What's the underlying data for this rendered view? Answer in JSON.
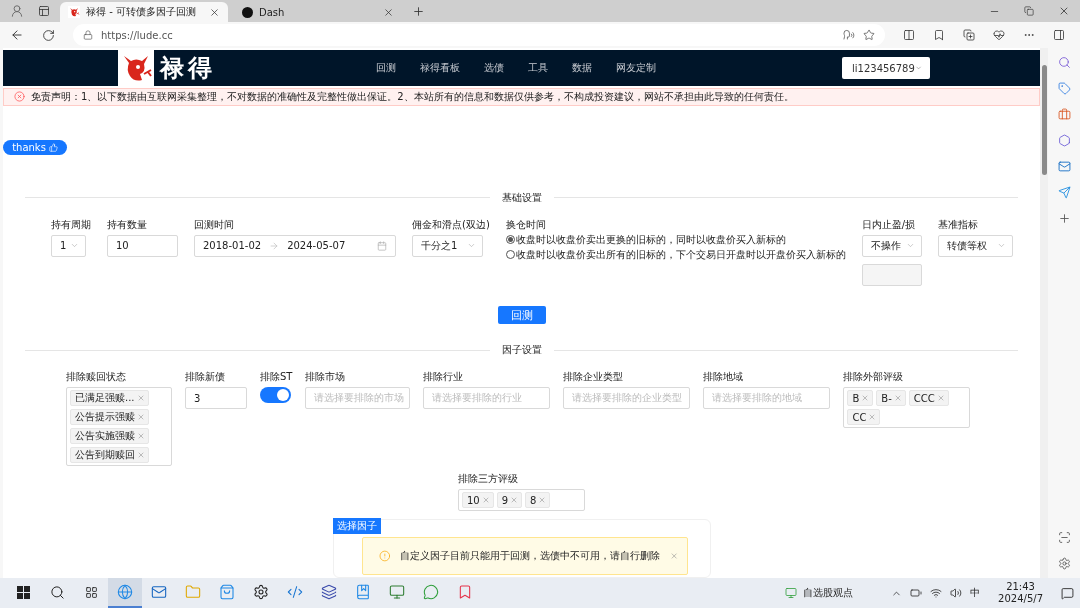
{
  "browser": {
    "tabs": [
      {
        "title": "禄得 - 可转债多因子回测",
        "selected": true
      },
      {
        "title": "Dash",
        "selected": false
      }
    ],
    "url": "https://lude.cc"
  },
  "navbar": {
    "brand": "禄得",
    "items": [
      "回测",
      "禄得看板",
      "选债",
      "工具",
      "数据",
      "网友定制"
    ],
    "user": "li123456789"
  },
  "alert": "免责声明：1、以下数据由互联网采集整理，不对数据的准确性及完整性做出保证。2、本站所有的信息和数据仅供参考，不构成投资建议，网站不承担由此导致的任何责任。",
  "thanks_button": "thanks",
  "basic_settings": {
    "title": "基础设置",
    "hold_period": {
      "label": "持有周期",
      "value": "1"
    },
    "hold_count": {
      "label": "持有数量",
      "value": "10"
    },
    "backtest_period": {
      "label": "回测时间",
      "start": "2018-01-02",
      "end": "2024-05-07"
    },
    "commission": {
      "label": "佣金和滑点(双边)",
      "value": "千分之1"
    },
    "rebalance": {
      "label": "换仓时间",
      "options": [
        {
          "label": "收盘时以收盘价卖出更换的旧标的，同时以收盘价买入新标的",
          "selected": true
        },
        {
          "label": "收盘时以收盘价卖出所有的旧标的，下个交易日开盘时以开盘价买入新标的",
          "selected": false
        }
      ]
    },
    "intraday_stop": {
      "label": "日内止盈/损",
      "value": "不操作"
    },
    "benchmark": {
      "label": "基准指标",
      "value": "转债等权"
    }
  },
  "run_button": "回测",
  "factor_settings": {
    "title": "因子设置",
    "redemption": {
      "label": "排除赎回状态",
      "tags": [
        "已满足强赎...",
        "公告提示强赎",
        "公告实施强赎",
        "公告到期赎回"
      ]
    },
    "new_bonds": {
      "label": "排除新债",
      "value": "3"
    },
    "exclude_st": {
      "label": "排除ST",
      "on": true
    },
    "empty_fields": [
      {
        "label": "排除市场",
        "placeholder": "请选择要排除的市场"
      },
      {
        "label": "排除行业",
        "placeholder": "请选择要排除的行业"
      },
      {
        "label": "排除企业类型",
        "placeholder": "请选择要排除的企业类型"
      },
      {
        "label": "排除地域",
        "placeholder": "请选择要排除的地域"
      }
    ],
    "external_rating": {
      "label": "排除外部评级",
      "tags": [
        "B",
        "B-",
        "CCC",
        "CC"
      ]
    },
    "third_party_rating": {
      "label": "排除三方评级",
      "tags": [
        "10",
        "9",
        "8"
      ]
    }
  },
  "factor_card": {
    "badge": "选择因子",
    "notice": "自定义因子目前只能用于回测，选债中不可用，请自行删除"
  },
  "taskbar": {
    "widget": "自选股观点",
    "input_method": "中",
    "time": "21:43",
    "date": "2024/5/7"
  }
}
